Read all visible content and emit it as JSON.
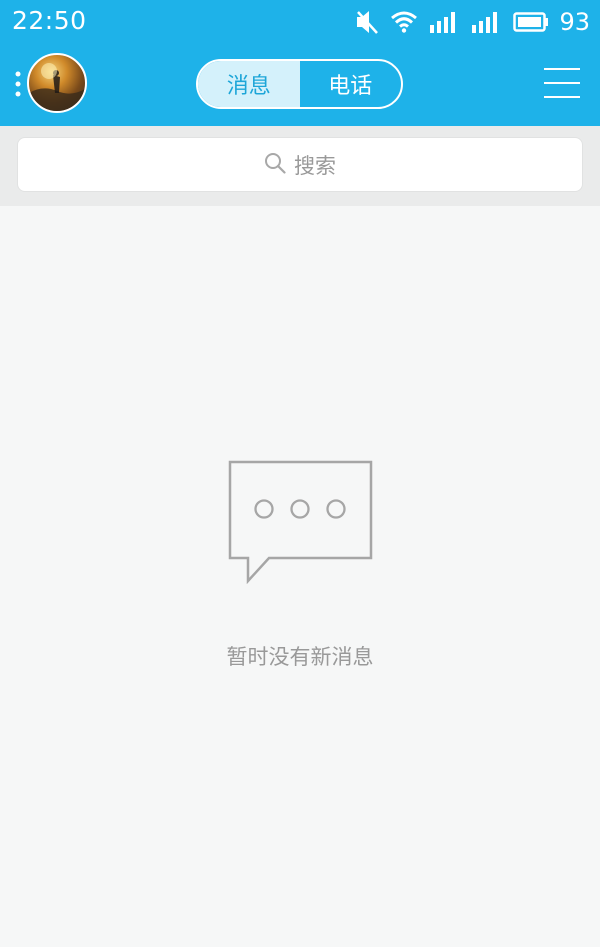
{
  "status_bar": {
    "time": "22:50",
    "battery": "93",
    "icons": [
      "mute-icon",
      "wifi-icon",
      "signal-icon",
      "signal-icon",
      "battery-icon"
    ]
  },
  "header": {
    "tabs": [
      {
        "label": "消息",
        "active": true
      },
      {
        "label": "电话",
        "active": false
      }
    ],
    "menu_icon": "hamburger-menu-icon"
  },
  "search": {
    "placeholder": "搜索",
    "icon": "search-icon"
  },
  "empty_state": {
    "icon": "chat-bubble-icon",
    "message": "暂时没有新消息"
  },
  "colors": {
    "accent": "#1eb2e9",
    "active_tab_bg": "#d4f1fb",
    "active_tab_text": "#1ea6d8",
    "background": "#f6f7f7",
    "muted_text": "#999999"
  }
}
